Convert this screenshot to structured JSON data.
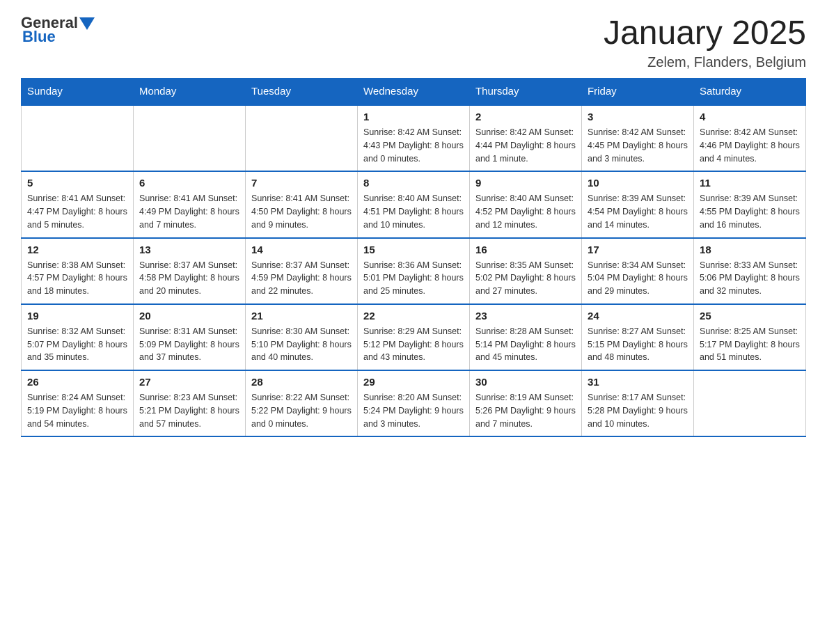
{
  "header": {
    "logo": {
      "general": "General",
      "blue": "Blue"
    },
    "title": "January 2025",
    "location": "Zelem, Flanders, Belgium"
  },
  "calendar": {
    "days": [
      "Sunday",
      "Monday",
      "Tuesday",
      "Wednesday",
      "Thursday",
      "Friday",
      "Saturday"
    ],
    "weeks": [
      [
        {
          "day": "",
          "info": ""
        },
        {
          "day": "",
          "info": ""
        },
        {
          "day": "",
          "info": ""
        },
        {
          "day": "1",
          "info": "Sunrise: 8:42 AM\nSunset: 4:43 PM\nDaylight: 8 hours\nand 0 minutes."
        },
        {
          "day": "2",
          "info": "Sunrise: 8:42 AM\nSunset: 4:44 PM\nDaylight: 8 hours\nand 1 minute."
        },
        {
          "day": "3",
          "info": "Sunrise: 8:42 AM\nSunset: 4:45 PM\nDaylight: 8 hours\nand 3 minutes."
        },
        {
          "day": "4",
          "info": "Sunrise: 8:42 AM\nSunset: 4:46 PM\nDaylight: 8 hours\nand 4 minutes."
        }
      ],
      [
        {
          "day": "5",
          "info": "Sunrise: 8:41 AM\nSunset: 4:47 PM\nDaylight: 8 hours\nand 5 minutes."
        },
        {
          "day": "6",
          "info": "Sunrise: 8:41 AM\nSunset: 4:49 PM\nDaylight: 8 hours\nand 7 minutes."
        },
        {
          "day": "7",
          "info": "Sunrise: 8:41 AM\nSunset: 4:50 PM\nDaylight: 8 hours\nand 9 minutes."
        },
        {
          "day": "8",
          "info": "Sunrise: 8:40 AM\nSunset: 4:51 PM\nDaylight: 8 hours\nand 10 minutes."
        },
        {
          "day": "9",
          "info": "Sunrise: 8:40 AM\nSunset: 4:52 PM\nDaylight: 8 hours\nand 12 minutes."
        },
        {
          "day": "10",
          "info": "Sunrise: 8:39 AM\nSunset: 4:54 PM\nDaylight: 8 hours\nand 14 minutes."
        },
        {
          "day": "11",
          "info": "Sunrise: 8:39 AM\nSunset: 4:55 PM\nDaylight: 8 hours\nand 16 minutes."
        }
      ],
      [
        {
          "day": "12",
          "info": "Sunrise: 8:38 AM\nSunset: 4:57 PM\nDaylight: 8 hours\nand 18 minutes."
        },
        {
          "day": "13",
          "info": "Sunrise: 8:37 AM\nSunset: 4:58 PM\nDaylight: 8 hours\nand 20 minutes."
        },
        {
          "day": "14",
          "info": "Sunrise: 8:37 AM\nSunset: 4:59 PM\nDaylight: 8 hours\nand 22 minutes."
        },
        {
          "day": "15",
          "info": "Sunrise: 8:36 AM\nSunset: 5:01 PM\nDaylight: 8 hours\nand 25 minutes."
        },
        {
          "day": "16",
          "info": "Sunrise: 8:35 AM\nSunset: 5:02 PM\nDaylight: 8 hours\nand 27 minutes."
        },
        {
          "day": "17",
          "info": "Sunrise: 8:34 AM\nSunset: 5:04 PM\nDaylight: 8 hours\nand 29 minutes."
        },
        {
          "day": "18",
          "info": "Sunrise: 8:33 AM\nSunset: 5:06 PM\nDaylight: 8 hours\nand 32 minutes."
        }
      ],
      [
        {
          "day": "19",
          "info": "Sunrise: 8:32 AM\nSunset: 5:07 PM\nDaylight: 8 hours\nand 35 minutes."
        },
        {
          "day": "20",
          "info": "Sunrise: 8:31 AM\nSunset: 5:09 PM\nDaylight: 8 hours\nand 37 minutes."
        },
        {
          "day": "21",
          "info": "Sunrise: 8:30 AM\nSunset: 5:10 PM\nDaylight: 8 hours\nand 40 minutes."
        },
        {
          "day": "22",
          "info": "Sunrise: 8:29 AM\nSunset: 5:12 PM\nDaylight: 8 hours\nand 43 minutes."
        },
        {
          "day": "23",
          "info": "Sunrise: 8:28 AM\nSunset: 5:14 PM\nDaylight: 8 hours\nand 45 minutes."
        },
        {
          "day": "24",
          "info": "Sunrise: 8:27 AM\nSunset: 5:15 PM\nDaylight: 8 hours\nand 48 minutes."
        },
        {
          "day": "25",
          "info": "Sunrise: 8:25 AM\nSunset: 5:17 PM\nDaylight: 8 hours\nand 51 minutes."
        }
      ],
      [
        {
          "day": "26",
          "info": "Sunrise: 8:24 AM\nSunset: 5:19 PM\nDaylight: 8 hours\nand 54 minutes."
        },
        {
          "day": "27",
          "info": "Sunrise: 8:23 AM\nSunset: 5:21 PM\nDaylight: 8 hours\nand 57 minutes."
        },
        {
          "day": "28",
          "info": "Sunrise: 8:22 AM\nSunset: 5:22 PM\nDaylight: 9 hours\nand 0 minutes."
        },
        {
          "day": "29",
          "info": "Sunrise: 8:20 AM\nSunset: 5:24 PM\nDaylight: 9 hours\nand 3 minutes."
        },
        {
          "day": "30",
          "info": "Sunrise: 8:19 AM\nSunset: 5:26 PM\nDaylight: 9 hours\nand 7 minutes."
        },
        {
          "day": "31",
          "info": "Sunrise: 8:17 AM\nSunset: 5:28 PM\nDaylight: 9 hours\nand 10 minutes."
        },
        {
          "day": "",
          "info": ""
        }
      ]
    ]
  }
}
